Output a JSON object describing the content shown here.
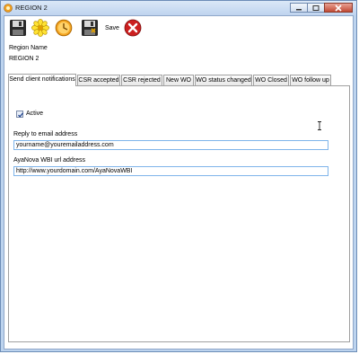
{
  "window": {
    "title": "REGION 2"
  },
  "toolbar": {
    "save_label": "Save"
  },
  "form": {
    "region_name_label": "Region Name",
    "region_name_value": "REGION 2"
  },
  "tabs": [
    {
      "label": "Send client notifications"
    },
    {
      "label": "CSR accepted"
    },
    {
      "label": "CSR rejected"
    },
    {
      "label": "New WO"
    },
    {
      "label": "WO status changed"
    },
    {
      "label": "WO Closed"
    },
    {
      "label": "WO follow up"
    }
  ],
  "panel": {
    "active_label": "Active",
    "active_checked": true,
    "reply_label": "Reply to email address",
    "reply_value": "yourname@youremailaddress.com",
    "url_label": "AyaNova WBI url address",
    "url_value": "http://www.yourdomain.com/AyaNovaWBI"
  },
  "icons": [
    "app-icon",
    "save-disk-icon",
    "yellow-star-icon",
    "clock-icon",
    "save-close-icon",
    "delete-icon"
  ]
}
